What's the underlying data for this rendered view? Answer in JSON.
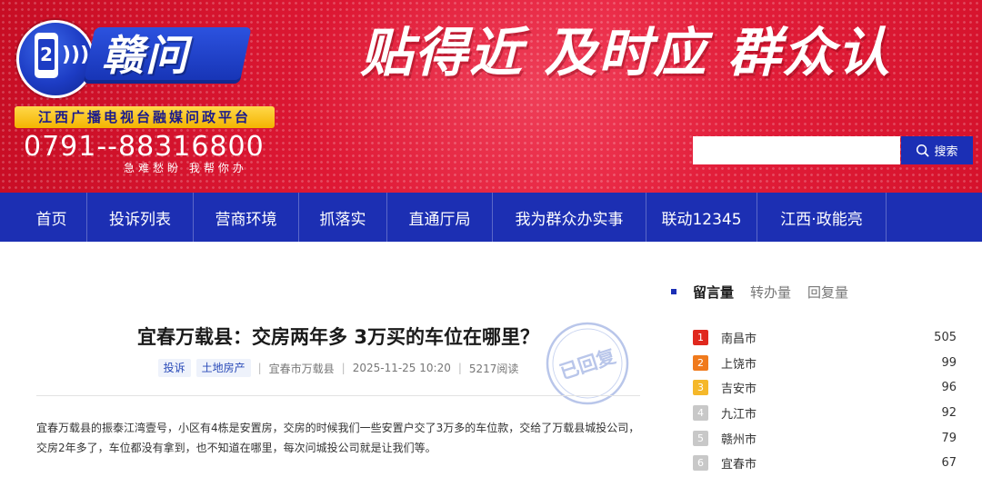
{
  "header": {
    "brand_name": "赣问",
    "slogan": "贴得近  及时应  群众认",
    "tagline": "江西广播电视台融媒问政平台",
    "hotline": "0791--88316800",
    "hotline_sub": "急难愁盼   我帮你办",
    "search_input_value": "",
    "search_label": "搜索",
    "accent_color": "#1c2fb3",
    "banner_color": "#e01f3a"
  },
  "nav": {
    "items": [
      {
        "label": "首页"
      },
      {
        "label": "投诉列表"
      },
      {
        "label": "营商环境"
      },
      {
        "label": "抓落实"
      },
      {
        "label": "直通厅局"
      },
      {
        "label": "我为群众办实事"
      },
      {
        "label": "联动12345"
      },
      {
        "label": "江西·政能亮"
      }
    ]
  },
  "article": {
    "title": "宜春万载县：交房两年多 3万买的车位在哪里？",
    "tags": [
      "投诉",
      "土地房产"
    ],
    "location": "宜春市万载县",
    "datetime": "2025-11-25 10:20",
    "reads": "5217阅读",
    "stamp": "已回复",
    "body": "宜春万载县的振泰江湾壹号，小区有4栋是安置房，交房的时候我们一些安置户交了3万多的车位款，交给了万载县城投公司，交房2年多了，车位都没有拿到，也不知道在哪里，每次问城投公司就是让我们等。"
  },
  "sidebar": {
    "tabs": [
      {
        "label": "留言量",
        "active": true
      },
      {
        "label": "转办量",
        "active": false
      },
      {
        "label": "回复量",
        "active": false
      }
    ],
    "ranking": [
      {
        "rank": "1",
        "city": "南昌市",
        "count": "505",
        "color": "#e0281e"
      },
      {
        "rank": "2",
        "city": "上饶市",
        "count": "99",
        "color": "#f07a1c"
      },
      {
        "rank": "3",
        "city": "吉安市",
        "count": "96",
        "color": "#f5b82a"
      },
      {
        "rank": "4",
        "city": "九江市",
        "count": "92",
        "color": "#c8c8c8"
      },
      {
        "rank": "5",
        "city": "赣州市",
        "count": "79",
        "color": "#c8c8c8"
      },
      {
        "rank": "6",
        "city": "宜春市",
        "count": "67",
        "color": "#c8c8c8"
      }
    ]
  }
}
